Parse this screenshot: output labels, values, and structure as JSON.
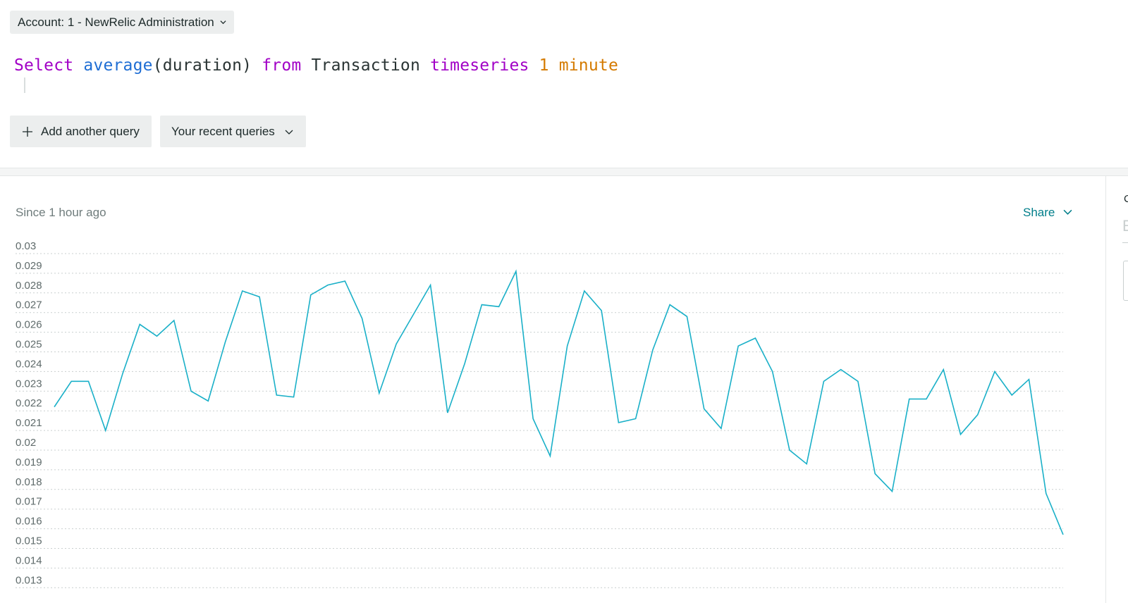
{
  "account_selector": {
    "label": "Account: 1 - NewRelic Administration",
    "icon": "chevron-down-icon"
  },
  "query": {
    "tokens": [
      {
        "text": "Select",
        "kind": "keyword"
      },
      {
        "text": " ",
        "kind": "plain"
      },
      {
        "text": "average",
        "kind": "function"
      },
      {
        "text": "(duration) ",
        "kind": "plain"
      },
      {
        "text": "from",
        "kind": "keyword"
      },
      {
        "text": " Transaction ",
        "kind": "plain"
      },
      {
        "text": "timeseries",
        "kind": "keyword"
      },
      {
        "text": " ",
        "kind": "plain"
      },
      {
        "text": "1 minute",
        "kind": "number"
      }
    ]
  },
  "actions": {
    "add_query": {
      "label": "Add another query",
      "icon": "plus-icon"
    },
    "recent_queries": {
      "label": "Your recent queries",
      "icon": "chevron-down-icon"
    }
  },
  "result": {
    "since": "Since 1 hour ago",
    "share_label": "Share",
    "side_panel_letter_1": "C",
    "side_panel_letter_2": "E"
  },
  "colors": {
    "series": "#1ab0c8",
    "keyword": "#a100c6",
    "function": "#1f6ed4",
    "number": "#d47a00",
    "link": "#007e8a"
  },
  "chart_data": {
    "type": "line",
    "title": "",
    "xlabel": "",
    "ylabel": "",
    "ylim": [
      0.013,
      0.03
    ],
    "yticks": [
      "0.03",
      "0.029",
      "0.028",
      "0.027",
      "0.026",
      "0.025",
      "0.024",
      "0.023",
      "0.022",
      "0.021",
      "0.02",
      "0.019",
      "0.018",
      "0.017",
      "0.016",
      "0.015",
      "0.014",
      "0.013"
    ],
    "grid": true,
    "x": [
      1,
      2,
      3,
      4,
      5,
      6,
      7,
      8,
      9,
      10,
      11,
      12,
      13,
      14,
      15,
      16,
      17,
      18,
      19,
      20,
      21,
      22,
      23,
      24,
      25,
      26,
      27,
      28,
      29,
      30,
      31,
      32,
      33,
      34,
      35,
      36,
      37,
      38,
      39,
      40,
      41,
      42,
      43,
      44,
      45,
      46,
      47,
      48,
      49,
      50,
      51,
      52,
      53,
      54,
      55,
      56,
      57,
      58,
      59,
      60,
      61,
      62
    ],
    "values": [
      0.0222,
      0.0235,
      0.0235,
      0.021,
      0.0239,
      0.0264,
      0.0258,
      0.0266,
      0.023,
      0.0225,
      0.0255,
      0.0281,
      0.0278,
      0.0228,
      0.0227,
      0.0279,
      0.0284,
      0.0286,
      0.0267,
      0.0229,
      0.0254,
      0.0269,
      0.0284,
      0.0219,
      0.0244,
      0.0274,
      0.0273,
      0.0291,
      0.0216,
      0.0197,
      0.0253,
      0.0281,
      0.0271,
      0.0214,
      0.0216,
      0.0251,
      0.0274,
      0.0268,
      0.0221,
      0.0211,
      0.0253,
      0.0257,
      0.024,
      0.02,
      0.0193,
      0.0235,
      0.0241,
      0.0235,
      0.0188,
      0.0179,
      0.0226,
      0.0226,
      0.0241,
      0.0208,
      0.0218,
      0.024,
      0.0228,
      0.0236,
      0.0178,
      0.0157
    ]
  }
}
